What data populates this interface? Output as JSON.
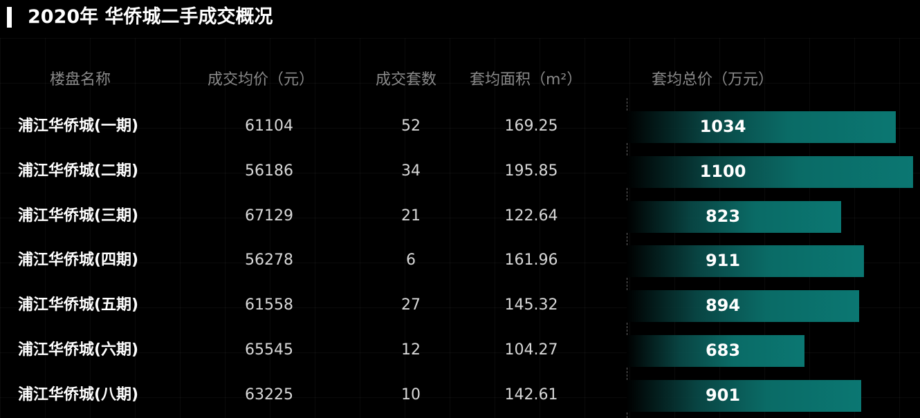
{
  "title": "2020年 华侨城二手成交概况",
  "headers": {
    "name": "楼盘名称",
    "avg_price": "成交均价（元）",
    "count": "成交套数",
    "area": "套均面积（m²）",
    "total": "套均总价（万元）"
  },
  "colors": {
    "background": "#000000",
    "bar": "#0b7772",
    "header_text": "#8a8a8a"
  },
  "chart_data": {
    "type": "table",
    "columns": [
      "楼盘名称",
      "成交均价（元）",
      "成交套数",
      "套均面积（m²）",
      "套均总价（万元）"
    ],
    "bar_column": "套均总价（万元）",
    "bar_max": 1100,
    "rows": [
      {
        "name": "浦江华侨城(一期)",
        "avg_price": "61104",
        "count": "52",
        "area": "169.25",
        "total": "1034",
        "total_value": 1034
      },
      {
        "name": "浦江华侨城(二期)",
        "avg_price": "56186",
        "count": "34",
        "area": "195.85",
        "total": "1100",
        "total_value": 1100
      },
      {
        "name": "浦江华侨城(三期)",
        "avg_price": "67129",
        "count": "21",
        "area": "122.64",
        "total": "823",
        "total_value": 823
      },
      {
        "name": "浦江华侨城(四期)",
        "avg_price": "56278",
        "count": "6",
        "area": "161.96",
        "total": "911",
        "total_value": 911
      },
      {
        "name": "浦江华侨城(五期)",
        "avg_price": "61558",
        "count": "27",
        "area": "145.32",
        "total": "894",
        "total_value": 894
      },
      {
        "name": "浦江华侨城(六期)",
        "avg_price": "65545",
        "count": "12",
        "area": "104.27",
        "total": "683",
        "total_value": 683
      },
      {
        "name": "浦江华侨城(八期)",
        "avg_price": "63225",
        "count": "10",
        "area": "142.61",
        "total": "901",
        "total_value": 901
      }
    ]
  }
}
